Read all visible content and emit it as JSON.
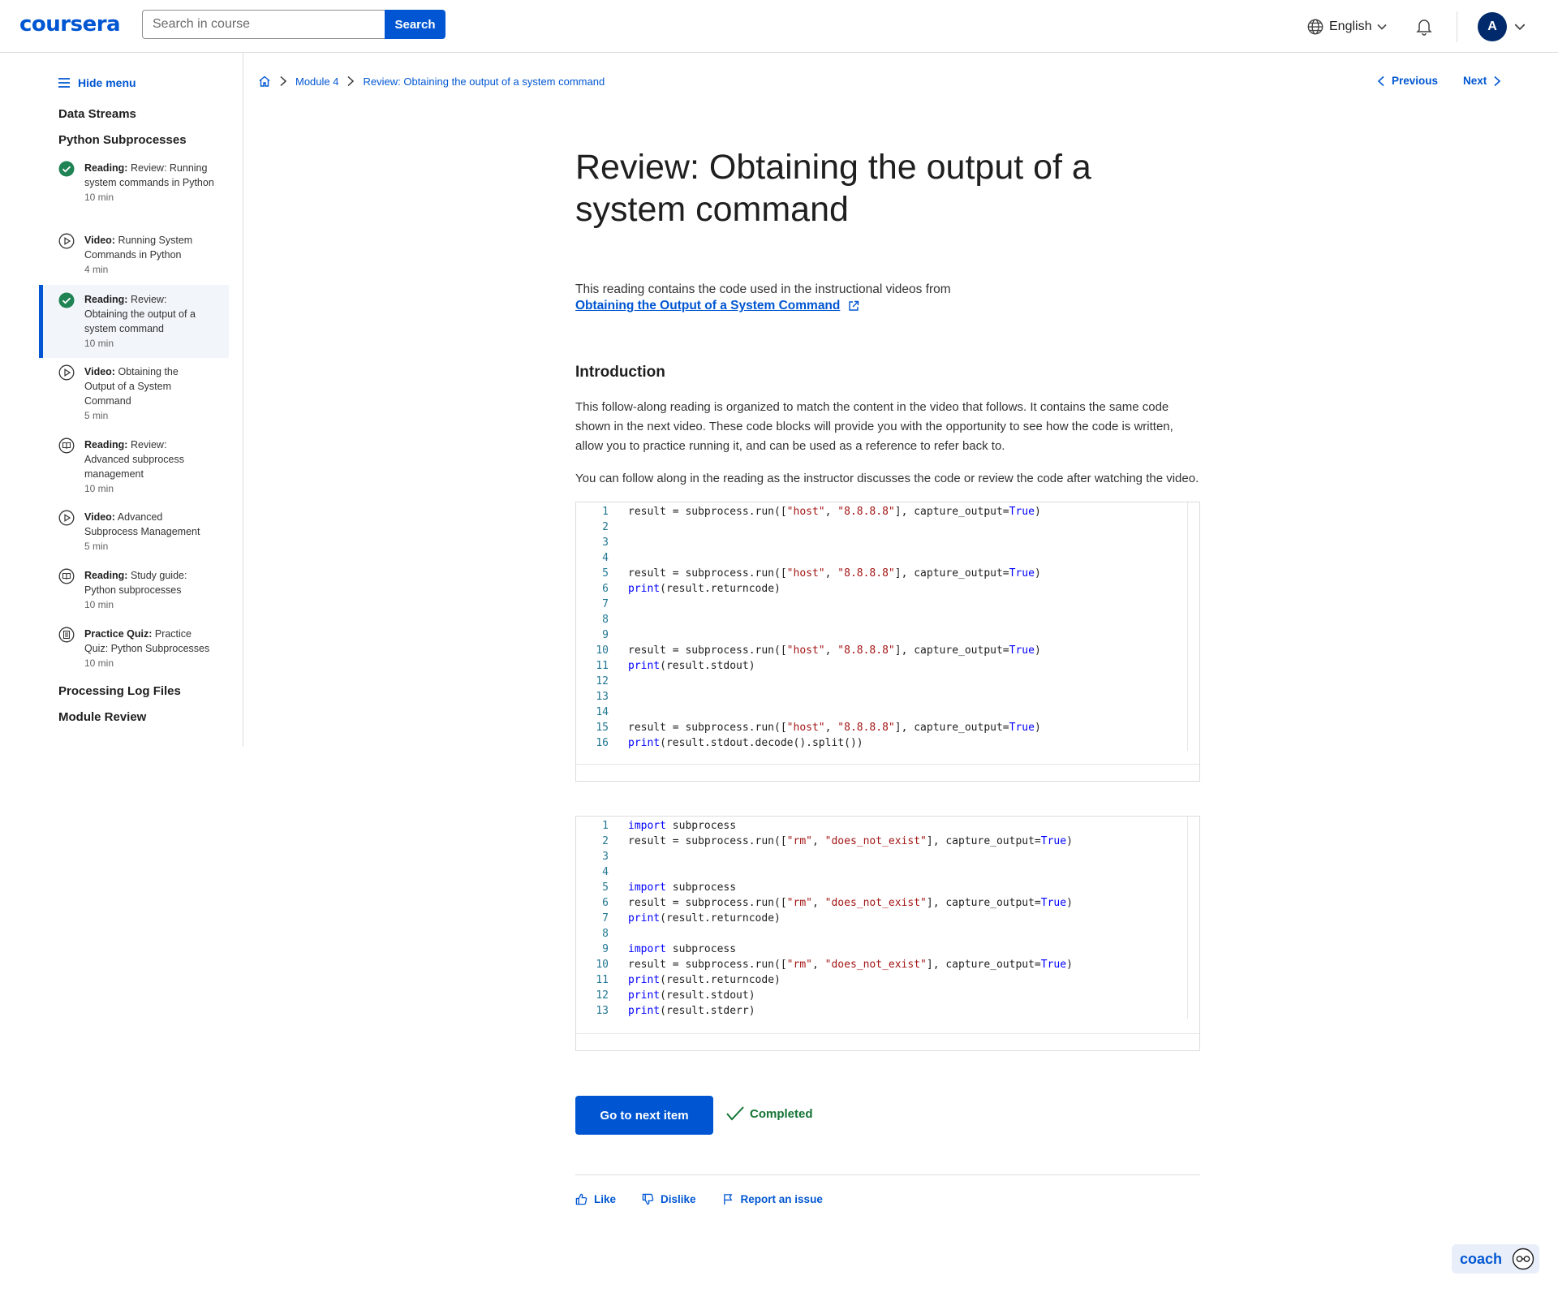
{
  "header": {
    "logo": "coursera",
    "search_placeholder": "Search in course",
    "search_button": "Search",
    "language": "English",
    "avatar_initial": "A"
  },
  "sidebar": {
    "hide_menu": "Hide menu",
    "sections_top": [
      "Data Streams",
      "Python Subprocesses"
    ],
    "items": [
      {
        "type": "Reading:",
        "title": "Review: Running system commands in Python",
        "duration": "10 min",
        "icon": "completed-check-icon",
        "active": false
      },
      {
        "type": "Video:",
        "title": "Running System Commands in Python",
        "duration": "4 min",
        "icon": "play-circle-icon",
        "active": false
      },
      {
        "type": "Reading:",
        "title": "Review: Obtaining the output of a system command",
        "duration": "10 min",
        "icon": "completed-check-icon",
        "active": true
      },
      {
        "type": "Video:",
        "title": "Obtaining the Output of a System Command",
        "duration": "5 min",
        "icon": "play-circle-icon",
        "active": false
      },
      {
        "type": "Reading:",
        "title": "Review: Advanced subprocess management",
        "duration": "10 min",
        "icon": "book-circle-icon",
        "active": false
      },
      {
        "type": "Video:",
        "title": "Advanced Subprocess Management",
        "duration": "5 min",
        "icon": "play-circle-icon",
        "active": false
      },
      {
        "type": "Reading:",
        "title": "Study guide: Python subprocesses",
        "duration": "10 min",
        "icon": "book-circle-icon",
        "active": false
      },
      {
        "type": "Practice Quiz:",
        "title": "Practice Quiz: Python Subprocesses",
        "duration": "10 min",
        "icon": "quiz-circle-icon",
        "active": false
      }
    ],
    "sections_bottom": [
      "Processing Log Files",
      "Module Review"
    ]
  },
  "breadcrumb": {
    "module": "Module 4",
    "current": "Review: Obtaining the output of a system command"
  },
  "nav": {
    "previous": "Previous",
    "next": "Next"
  },
  "content": {
    "title": "Review: Obtaining the output of a system command",
    "intro": "This reading contains the code used in the instructional videos from",
    "link": "Obtaining the Output of a System Command",
    "heading": "Introduction",
    "para1": "This follow-along reading is organized to match the content in the video that follows. It contains the same code shown in the next video. These code blocks will provide you with the opportunity to see how the code is written, allow you to practice running it, and can be used as a reference to refer back to.",
    "para2": "You can follow along in the reading as the instructor discusses the code or review the code after watching the video.",
    "code_block_1": [
      "result = subprocess.run([\"host\", \"8.8.8.8\"], capture_output=True)",
      "",
      "",
      "",
      "result = subprocess.run([\"host\", \"8.8.8.8\"], capture_output=True)",
      "print(result.returncode)",
      "",
      "",
      "",
      "result = subprocess.run([\"host\", \"8.8.8.8\"], capture_output=True)",
      "print(result.stdout)",
      "",
      "",
      "",
      "result = subprocess.run([\"host\", \"8.8.8.8\"], capture_output=True)",
      "print(result.stdout.decode().split())"
    ],
    "code_block_2": [
      "import subprocess",
      "result = subprocess.run([\"rm\", \"does_not_exist\"], capture_output=True)",
      "",
      "",
      "import subprocess",
      "result = subprocess.run([\"rm\", \"does_not_exist\"], capture_output=True)",
      "print(result.returncode)",
      "",
      "import subprocess",
      "result = subprocess.run([\"rm\", \"does_not_exist\"], capture_output=True)",
      "print(result.returncode)",
      "print(result.stdout)",
      "print(result.stderr)"
    ],
    "next_button": "Go to next item",
    "completed": "Completed",
    "like": "Like",
    "dislike": "Dislike",
    "report": "Report an issue"
  },
  "coach": {
    "label": "coach"
  },
  "colors": {
    "brand": "#0056d2",
    "success": "#137333",
    "code_keyword": "#0000ff",
    "code_string": "#a31515",
    "line_number": "#237893"
  }
}
